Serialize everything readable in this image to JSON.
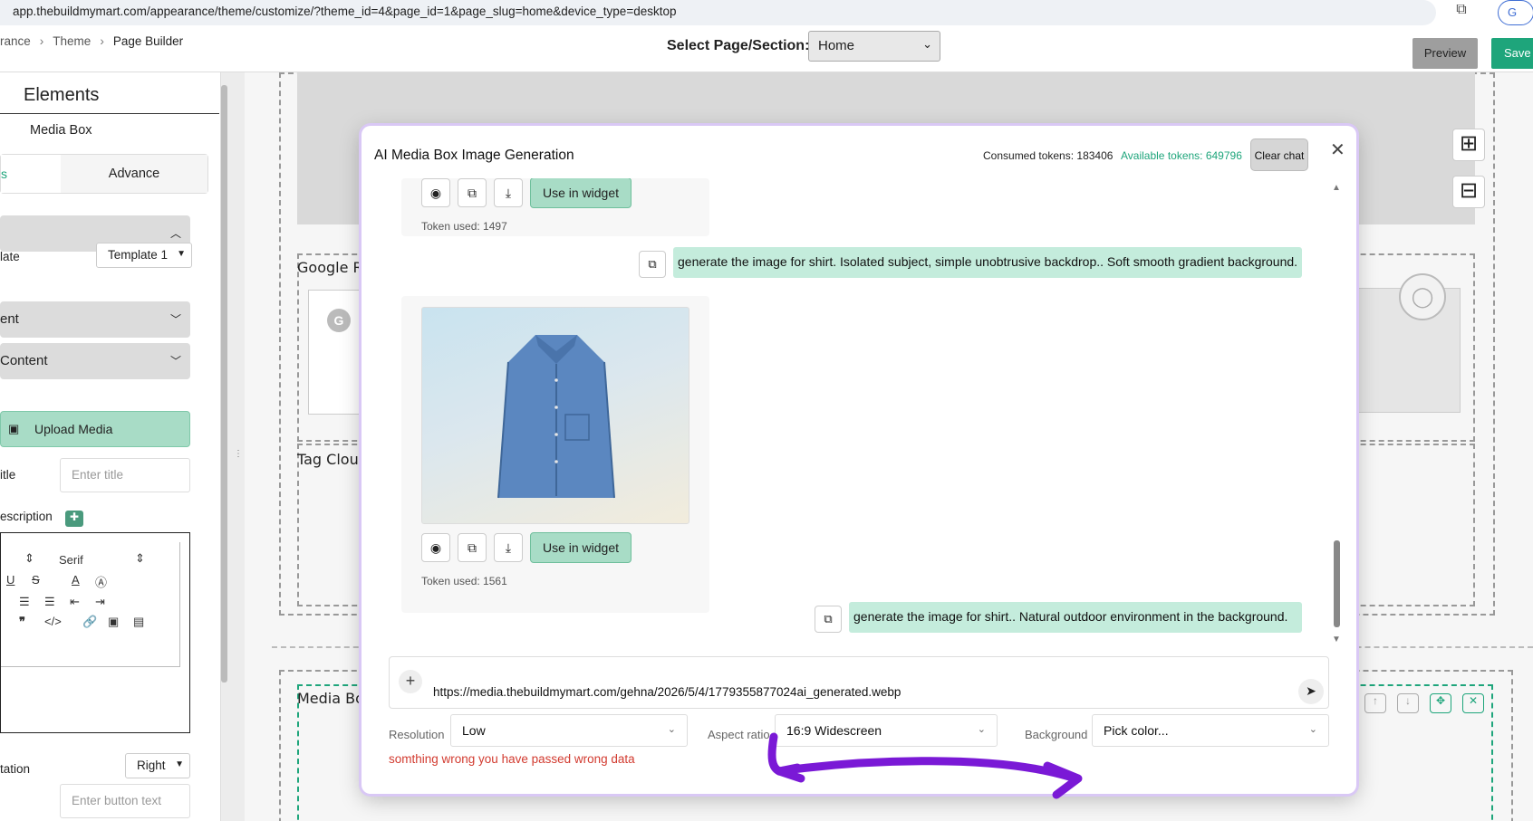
{
  "browser": {
    "url": "app.thebuildmymart.com/appearance/theme/customize/?theme_id=4&page_id=1&page_slug=home&device_type=desktop",
    "profile_initial": "G"
  },
  "header": {
    "breadcrumb": [
      "rance",
      "Theme",
      "Page Builder"
    ],
    "select_label": "Select Page/Section:",
    "page_value": "Home",
    "preview_label": "Preview",
    "save_label": "Save p"
  },
  "sidebar": {
    "title": "Elements",
    "subtitle": "Media Box",
    "tab_active": "s",
    "tab_other": "Advance",
    "template_label": "late",
    "template_value": "Template 1",
    "acc_content": "ent",
    "acc_media_content": "Content",
    "upload_label": "Upload Media",
    "title_label": "itle",
    "title_placeholder": "Enter title",
    "description_label": "escription",
    "editor_font": "Serif",
    "orientation_label": "tation",
    "orientation_value": "Right",
    "button_placeholder": "Enter button text"
  },
  "canvas": {
    "google_label": "Google Re",
    "tag_label": "Tag Clouc",
    "media_label": "Media Bo",
    "google_initial": "G"
  },
  "modal": {
    "title": "AI Media Box Image Generation",
    "consumed": "Consumed tokens: 183406",
    "available": "Available tokens: 649796",
    "clear_chat": "Clear chat",
    "messages": {
      "use_label": "Use in widget",
      "token_1": "Token used: 1497",
      "user_1": "generate the image for shirt. Isolated subject, simple unobtrusive backdrop.. Soft smooth gradient background.",
      "token_2": "Token used: 1561",
      "user_2": "generate the image for shirt.. Natural outdoor environment in the background."
    },
    "input_value": "https://media.thebuildmymart.com/gehna/2026/5/4/1779355877024ai_generated.webp",
    "resolution_label": "Resolution",
    "resolution_value": "Low",
    "aspect_label": "Aspect ratio",
    "aspect_value": "16:9 Widescreen",
    "background_label": "Background",
    "background_value": "Pick color...",
    "error": "somthing wrong you have passed wrong data"
  },
  "colors": {
    "accent": "#1ea57b",
    "use_button_bg": "#a8dcc6",
    "user_bubble": "#c4ecdc",
    "error": "#d23a2f",
    "annotation": "#7a19d6"
  }
}
